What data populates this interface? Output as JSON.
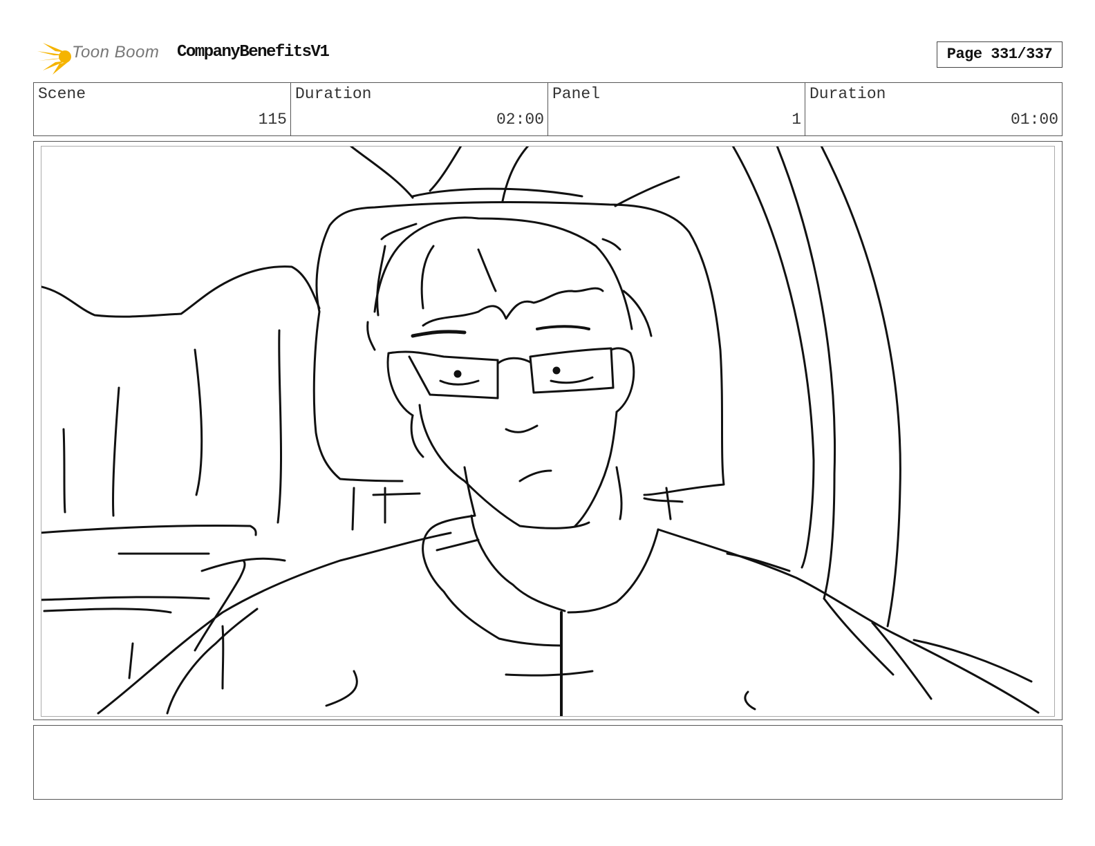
{
  "header": {
    "logo_text": "Toon Boom",
    "project_title": "CompanyBenefitsV1",
    "page_label": "Page 331/337"
  },
  "info": {
    "scene_label": "Scene",
    "scene_value": "115",
    "scene_duration_label": "Duration",
    "scene_duration_value": "02:00",
    "panel_label": "Panel",
    "panel_value": "1",
    "panel_duration_label": "Duration",
    "panel_duration_value": "01:00"
  },
  "caption": {
    "text": ""
  },
  "colors": {
    "logo_star": "#f5b400",
    "logo_text": "#777777",
    "border": "#555555",
    "sketch_line": "#111111"
  }
}
